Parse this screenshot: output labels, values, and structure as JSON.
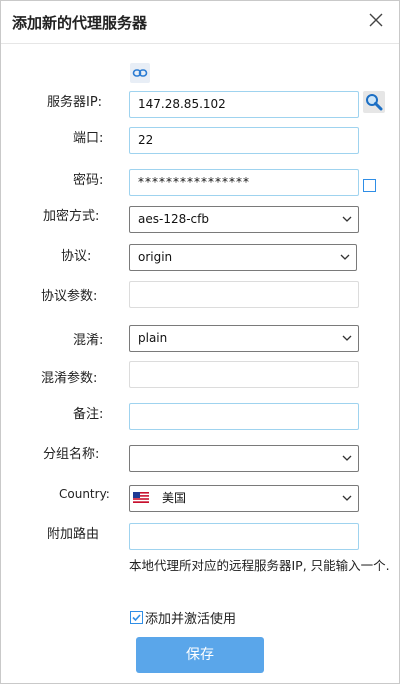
{
  "dialog": {
    "title": "添加新的代理服务器"
  },
  "form": {
    "server_ip_label": "服务器IP:",
    "server_ip_value": "147.28.85.102",
    "port_label": "端口:",
    "port_value": "22",
    "password_label": "密码:",
    "password_value": "****************",
    "encryption_label": "加密方式:",
    "encryption_value": "aes-128-cfb",
    "protocol_label": "协议:",
    "protocol_value": "origin",
    "protocol_param_label": "协议参数:",
    "protocol_param_value": "",
    "obfs_label": "混淆:",
    "obfs_value": "plain",
    "obfs_param_label": "混淆参数:",
    "obfs_param_value": "",
    "remark_label": "备注:",
    "remark_value": "",
    "group_label": "分组名称:",
    "group_value": "",
    "country_label": "Country:",
    "country_value": "美国",
    "extra_route_label": "附加路由",
    "extra_route_value": "",
    "hint_text": "本地代理所对应的远程服务器IP, 只能输入一个.",
    "activate_label": "添加并激活使用",
    "activate_checked": true,
    "save_label": "保存"
  },
  "colors": {
    "accent": "#5aa6ea",
    "field_border": "#9fd3ef",
    "checkbox": "#2f8ee6"
  },
  "icons": [
    "close-icon",
    "link-icon",
    "search-icon",
    "chevron-down-icon",
    "us-flag-icon",
    "checkbox-icon"
  ]
}
